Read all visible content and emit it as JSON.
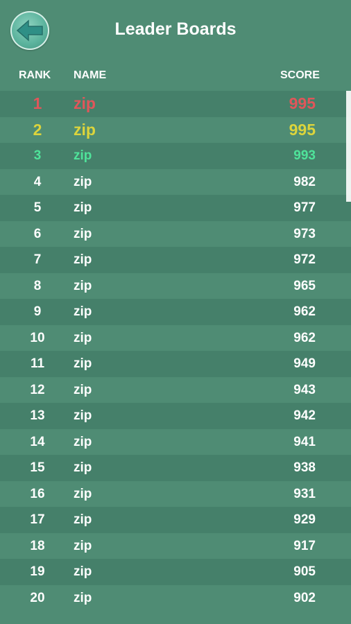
{
  "header": {
    "title": "Leader Boards",
    "back_icon": "back-arrow-icon"
  },
  "columns": {
    "rank": "RANK",
    "name": "NAME",
    "score": "SCORE"
  },
  "colors": {
    "background": "#4f8c74",
    "row_alt": "#45806a",
    "first": "#e0565a",
    "second": "#dcd43c",
    "third": "#4fe39a",
    "default": "#ffffff"
  },
  "entries": [
    {
      "rank": "1",
      "name": "zip",
      "score": "995"
    },
    {
      "rank": "2",
      "name": "zip",
      "score": "995"
    },
    {
      "rank": "3",
      "name": "zip",
      "score": "993"
    },
    {
      "rank": "4",
      "name": "zip",
      "score": "982"
    },
    {
      "rank": "5",
      "name": "zip",
      "score": "977"
    },
    {
      "rank": "6",
      "name": "zip",
      "score": "973"
    },
    {
      "rank": "7",
      "name": "zip",
      "score": "972"
    },
    {
      "rank": "8",
      "name": "zip",
      "score": "965"
    },
    {
      "rank": "9",
      "name": "zip",
      "score": "962"
    },
    {
      "rank": "10",
      "name": "zip",
      "score": "962"
    },
    {
      "rank": "11",
      "name": "zip",
      "score": "949"
    },
    {
      "rank": "12",
      "name": "zip",
      "score": "943"
    },
    {
      "rank": "13",
      "name": "zip",
      "score": "942"
    },
    {
      "rank": "14",
      "name": "zip",
      "score": "941"
    },
    {
      "rank": "15",
      "name": "zip",
      "score": "938"
    },
    {
      "rank": "16",
      "name": "zip",
      "score": "931"
    },
    {
      "rank": "17",
      "name": "zip",
      "score": "929"
    },
    {
      "rank": "18",
      "name": "zip",
      "score": "917"
    },
    {
      "rank": "19",
      "name": "zip",
      "score": "905"
    },
    {
      "rank": "20",
      "name": "zip",
      "score": "902"
    }
  ]
}
